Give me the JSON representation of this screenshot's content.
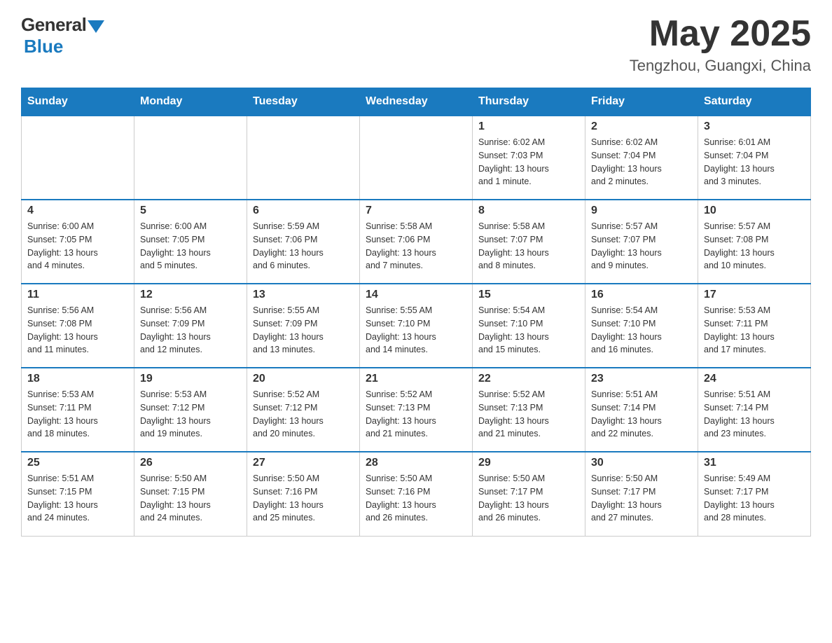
{
  "header": {
    "logo_general": "General",
    "logo_blue": "Blue",
    "month_year": "May 2025",
    "location": "Tengzhou, Guangxi, China"
  },
  "weekdays": [
    "Sunday",
    "Monday",
    "Tuesday",
    "Wednesday",
    "Thursday",
    "Friday",
    "Saturday"
  ],
  "weeks": [
    [
      {
        "day": "",
        "info": ""
      },
      {
        "day": "",
        "info": ""
      },
      {
        "day": "",
        "info": ""
      },
      {
        "day": "",
        "info": ""
      },
      {
        "day": "1",
        "info": "Sunrise: 6:02 AM\nSunset: 7:03 PM\nDaylight: 13 hours\nand 1 minute."
      },
      {
        "day": "2",
        "info": "Sunrise: 6:02 AM\nSunset: 7:04 PM\nDaylight: 13 hours\nand 2 minutes."
      },
      {
        "day": "3",
        "info": "Sunrise: 6:01 AM\nSunset: 7:04 PM\nDaylight: 13 hours\nand 3 minutes."
      }
    ],
    [
      {
        "day": "4",
        "info": "Sunrise: 6:00 AM\nSunset: 7:05 PM\nDaylight: 13 hours\nand 4 minutes."
      },
      {
        "day": "5",
        "info": "Sunrise: 6:00 AM\nSunset: 7:05 PM\nDaylight: 13 hours\nand 5 minutes."
      },
      {
        "day": "6",
        "info": "Sunrise: 5:59 AM\nSunset: 7:06 PM\nDaylight: 13 hours\nand 6 minutes."
      },
      {
        "day": "7",
        "info": "Sunrise: 5:58 AM\nSunset: 7:06 PM\nDaylight: 13 hours\nand 7 minutes."
      },
      {
        "day": "8",
        "info": "Sunrise: 5:58 AM\nSunset: 7:07 PM\nDaylight: 13 hours\nand 8 minutes."
      },
      {
        "day": "9",
        "info": "Sunrise: 5:57 AM\nSunset: 7:07 PM\nDaylight: 13 hours\nand 9 minutes."
      },
      {
        "day": "10",
        "info": "Sunrise: 5:57 AM\nSunset: 7:08 PM\nDaylight: 13 hours\nand 10 minutes."
      }
    ],
    [
      {
        "day": "11",
        "info": "Sunrise: 5:56 AM\nSunset: 7:08 PM\nDaylight: 13 hours\nand 11 minutes."
      },
      {
        "day": "12",
        "info": "Sunrise: 5:56 AM\nSunset: 7:09 PM\nDaylight: 13 hours\nand 12 minutes."
      },
      {
        "day": "13",
        "info": "Sunrise: 5:55 AM\nSunset: 7:09 PM\nDaylight: 13 hours\nand 13 minutes."
      },
      {
        "day": "14",
        "info": "Sunrise: 5:55 AM\nSunset: 7:10 PM\nDaylight: 13 hours\nand 14 minutes."
      },
      {
        "day": "15",
        "info": "Sunrise: 5:54 AM\nSunset: 7:10 PM\nDaylight: 13 hours\nand 15 minutes."
      },
      {
        "day": "16",
        "info": "Sunrise: 5:54 AM\nSunset: 7:10 PM\nDaylight: 13 hours\nand 16 minutes."
      },
      {
        "day": "17",
        "info": "Sunrise: 5:53 AM\nSunset: 7:11 PM\nDaylight: 13 hours\nand 17 minutes."
      }
    ],
    [
      {
        "day": "18",
        "info": "Sunrise: 5:53 AM\nSunset: 7:11 PM\nDaylight: 13 hours\nand 18 minutes."
      },
      {
        "day": "19",
        "info": "Sunrise: 5:53 AM\nSunset: 7:12 PM\nDaylight: 13 hours\nand 19 minutes."
      },
      {
        "day": "20",
        "info": "Sunrise: 5:52 AM\nSunset: 7:12 PM\nDaylight: 13 hours\nand 20 minutes."
      },
      {
        "day": "21",
        "info": "Sunrise: 5:52 AM\nSunset: 7:13 PM\nDaylight: 13 hours\nand 21 minutes."
      },
      {
        "day": "22",
        "info": "Sunrise: 5:52 AM\nSunset: 7:13 PM\nDaylight: 13 hours\nand 21 minutes."
      },
      {
        "day": "23",
        "info": "Sunrise: 5:51 AM\nSunset: 7:14 PM\nDaylight: 13 hours\nand 22 minutes."
      },
      {
        "day": "24",
        "info": "Sunrise: 5:51 AM\nSunset: 7:14 PM\nDaylight: 13 hours\nand 23 minutes."
      }
    ],
    [
      {
        "day": "25",
        "info": "Sunrise: 5:51 AM\nSunset: 7:15 PM\nDaylight: 13 hours\nand 24 minutes."
      },
      {
        "day": "26",
        "info": "Sunrise: 5:50 AM\nSunset: 7:15 PM\nDaylight: 13 hours\nand 24 minutes."
      },
      {
        "day": "27",
        "info": "Sunrise: 5:50 AM\nSunset: 7:16 PM\nDaylight: 13 hours\nand 25 minutes."
      },
      {
        "day": "28",
        "info": "Sunrise: 5:50 AM\nSunset: 7:16 PM\nDaylight: 13 hours\nand 26 minutes."
      },
      {
        "day": "29",
        "info": "Sunrise: 5:50 AM\nSunset: 7:17 PM\nDaylight: 13 hours\nand 26 minutes."
      },
      {
        "day": "30",
        "info": "Sunrise: 5:50 AM\nSunset: 7:17 PM\nDaylight: 13 hours\nand 27 minutes."
      },
      {
        "day": "31",
        "info": "Sunrise: 5:49 AM\nSunset: 7:17 PM\nDaylight: 13 hours\nand 28 minutes."
      }
    ]
  ]
}
